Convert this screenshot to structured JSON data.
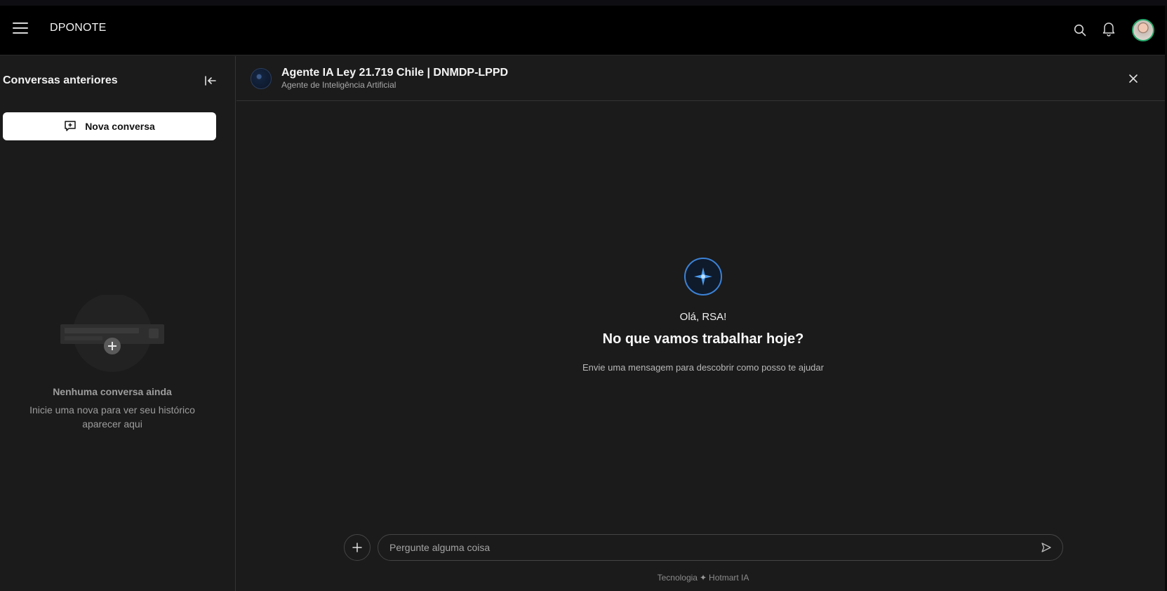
{
  "header": {
    "brand": "DPONOTE",
    "icons": [
      "menu-icon",
      "search-icon",
      "bell-icon",
      "avatar"
    ]
  },
  "sidebar": {
    "title": "Conversas anteriores",
    "new_chat_label": "Nova conversa",
    "empty_title": "Nenhuma conversa ainda",
    "empty_subtitle": "Inicie uma nova para ver seu histórico aparecer aqui"
  },
  "agent": {
    "name": "Agente IA Ley 21.719 Chile | DNMDP-LPPD",
    "subtitle": "Agente de Inteligência Artificial"
  },
  "hero": {
    "greeting": "Olá, RSA!",
    "title": "No que vamos trabalhar hoje?",
    "subtitle": "Envie uma mensagem para descobrir como posso te ajudar"
  },
  "composer": {
    "placeholder": "Pergunte alguma coisa"
  },
  "footer": {
    "tech_label": "Tecnologia",
    "provider": "Hotmart IA"
  },
  "colors": {
    "background": "#1b1b1b",
    "header": "#000000",
    "accent": "#3b82d6",
    "avatar_ring": "#25a86a"
  }
}
